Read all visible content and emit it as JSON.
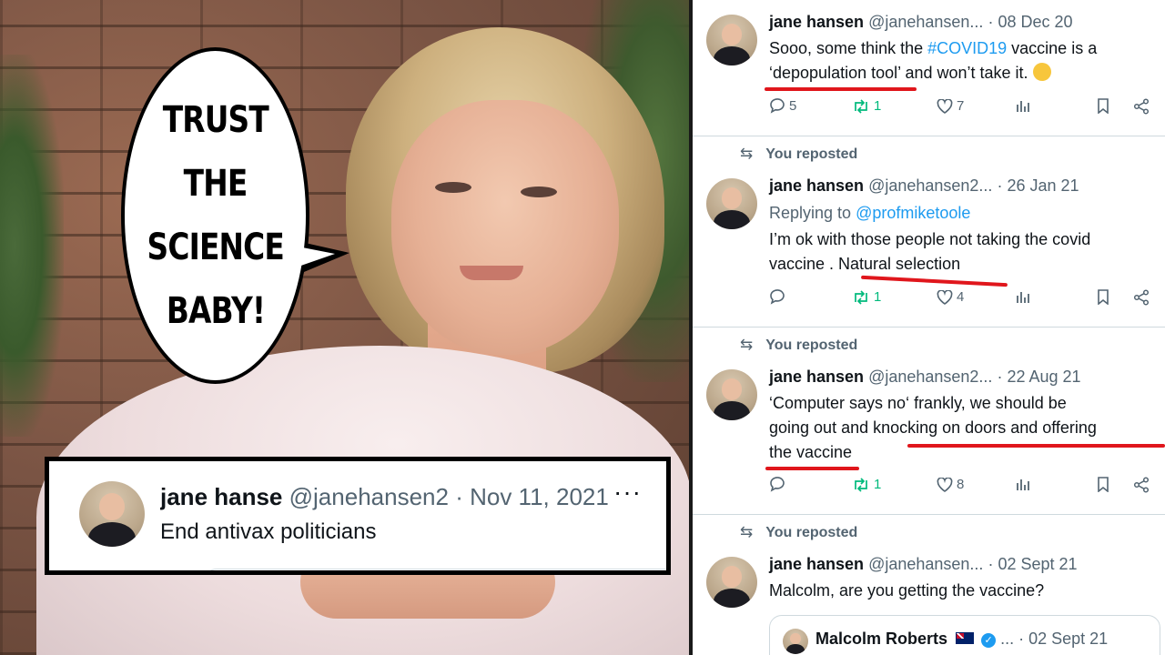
{
  "speech_bubble": {
    "lines": [
      "TRUST",
      "THE",
      "SCIENCE",
      "BABY!"
    ]
  },
  "photo_tweet": {
    "name": "jane hanse",
    "handle": "@janehansen2",
    "date": "Nov 11, 2021",
    "more": "···",
    "text": "End antivax politicians"
  },
  "timeline": {
    "posts": [
      {
        "name": "jane hansen",
        "handle": "@janehansen...",
        "date": "· 08 Dec 20",
        "text_pre": "Sooo, some think the ",
        "hashtag": "#COVID19",
        "text_mid": " vaccine is a",
        "text_line2": "‘depopulation tool’ and won’t take it.",
        "actions": {
          "replies": "5",
          "reposts": "1",
          "likes": "7"
        }
      },
      {
        "repost_label": "You reposted",
        "name": "jane hansen",
        "handle": "@janehansen2...",
        "date": "· 26 Jan 21",
        "replying_label": "Replying to ",
        "replying_to": "@profmiketoole",
        "text_line1": "I’m ok with those people not taking the covid",
        "text_line2": "vaccine . Natural selection",
        "actions": {
          "replies": "",
          "reposts": "1",
          "likes": "4"
        }
      },
      {
        "repost_label": "You reposted",
        "name": "jane hansen",
        "handle": "@janehansen2...",
        "date": "· 22 Aug 21",
        "text_line1": "‘Computer says no‘  frankly, we should be",
        "text_line2": "going out and knocking on doors and offering",
        "text_line3": "the vaccine",
        "actions": {
          "replies": "",
          "reposts": "1",
          "likes": "8"
        }
      },
      {
        "repost_label": "You reposted",
        "name": "jane hansen",
        "handle": "@janehansen...",
        "date": "· 02 Sept 21",
        "text_line1": "Malcolm, are you getting the vaccine?",
        "quote": {
          "name": "Malcolm Roberts",
          "more": "...",
          "date": "· 02 Sept 21"
        }
      }
    ]
  },
  "colors": {
    "link_blue": "#1d9bf0",
    "repost_green": "#00ba7c",
    "muted_gray": "#536471",
    "underline_red": "#e0161c"
  },
  "icons": [
    "reply-icon",
    "repost-icon",
    "like-icon",
    "views-icon",
    "bookmark-icon",
    "share-icon",
    "verified-icon",
    "flag-icon",
    "thinking-emoji"
  ]
}
